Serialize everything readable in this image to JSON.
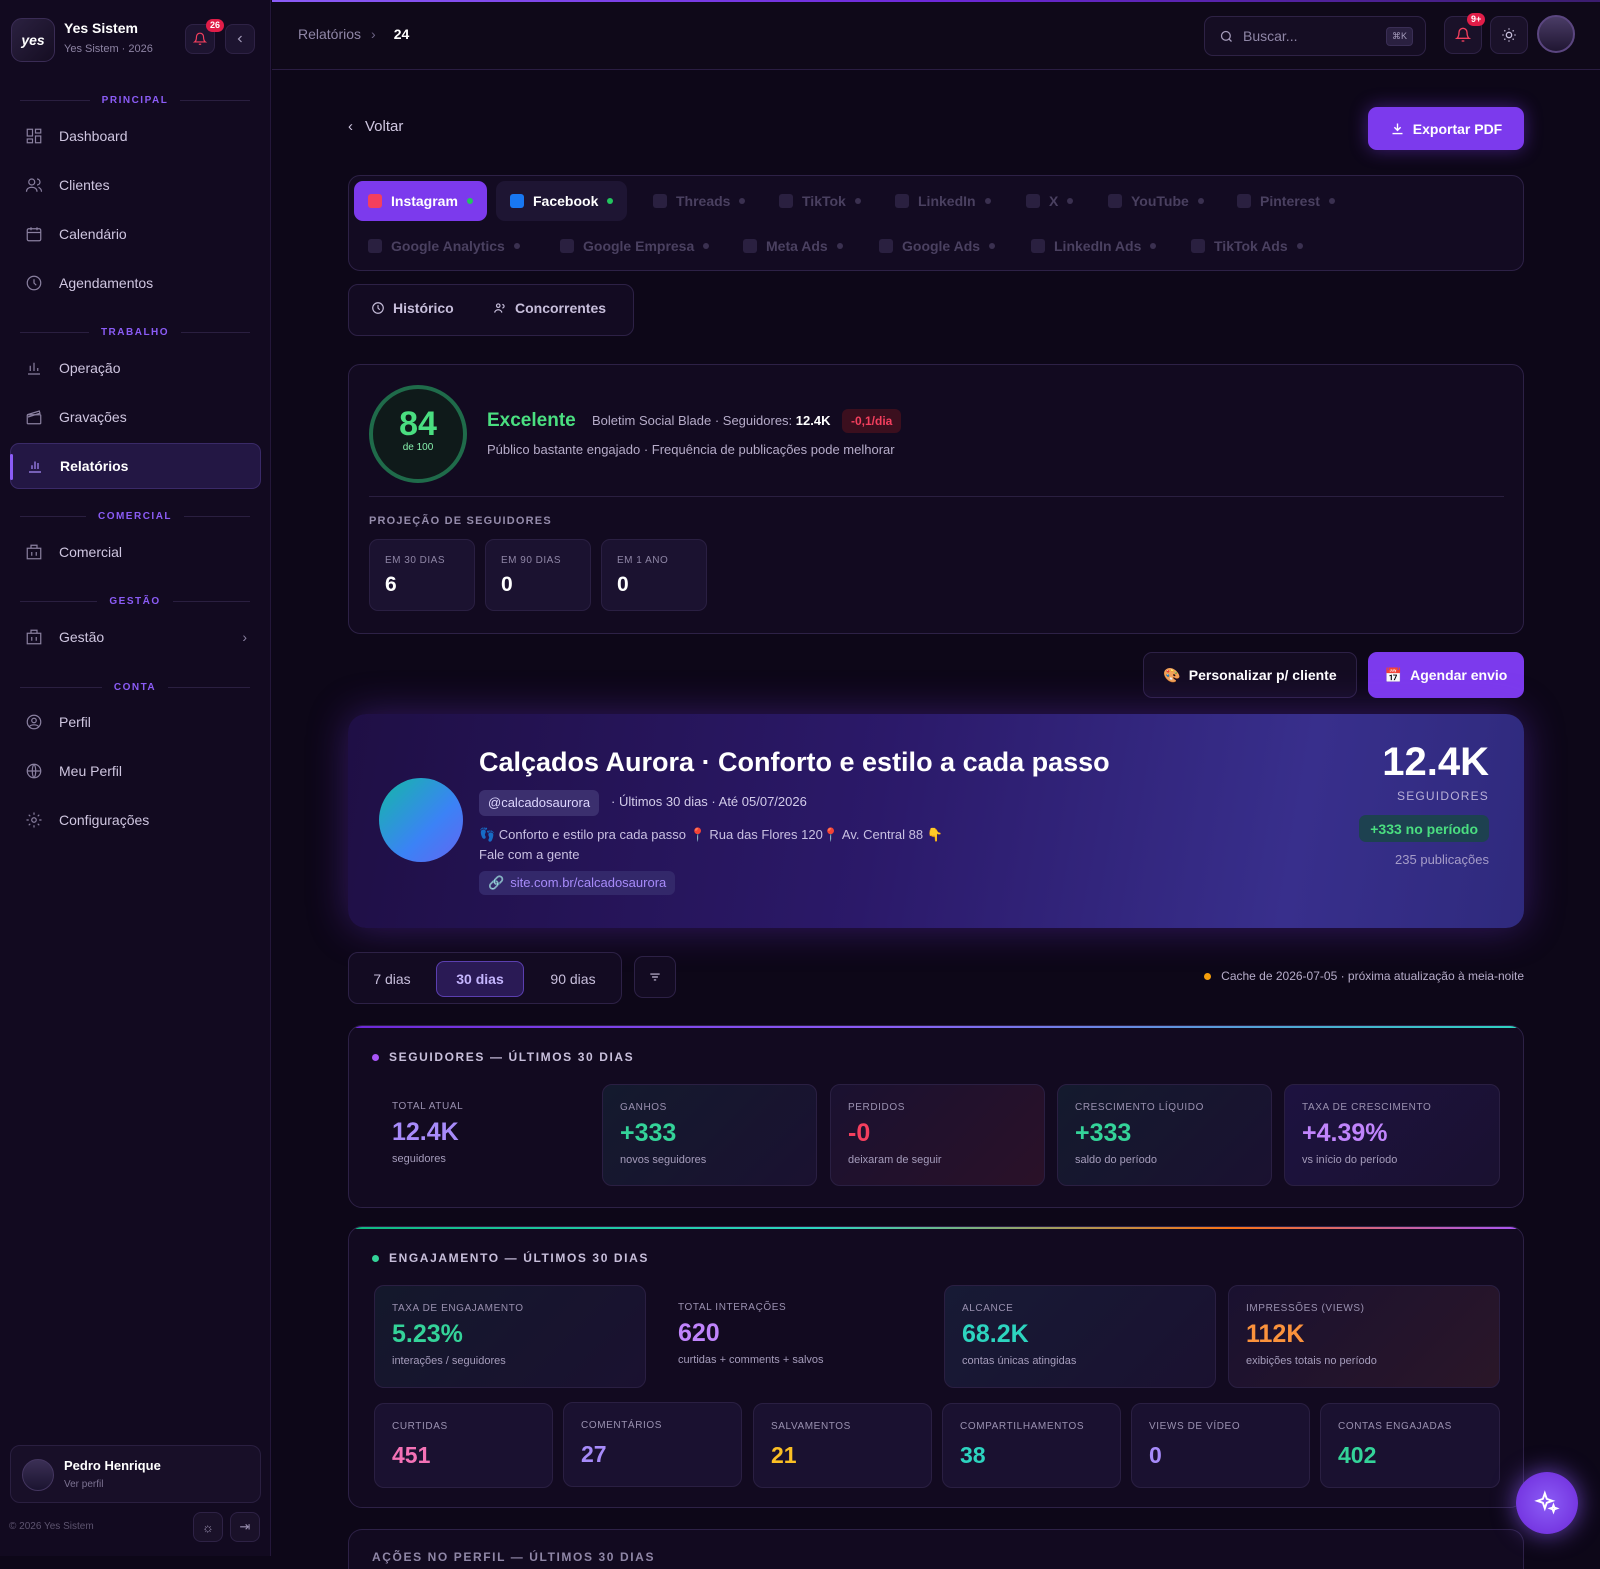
{
  "sidebar": {
    "brand_name": "Yes Sistem",
    "brand_sub": "Yes Sistem · 2026",
    "logo_text": "yes",
    "notif_count": "26",
    "sections": {
      "principal": "PRINCIPAL",
      "trabalho": "TRABALHO",
      "comercial": "COMERCIAL",
      "gestao": "GESTÃO",
      "conta": "CONTA"
    },
    "items": [
      "Dashboard",
      "Clientes",
      "Calendário",
      "Agendamentos",
      "Operação",
      "Gravações",
      "Relatórios",
      "Comercial",
      "Gestão",
      "Perfil",
      "Meu Perfil",
      "Configurações"
    ],
    "user_name": "Pedro Henrique",
    "user_sub": "Ver perfil",
    "copyright": "© 2026 Yes Sistem"
  },
  "header": {
    "breadcrumb_root": "Relatórios",
    "breadcrumb_current": "24",
    "search_placeholder": "Buscar...",
    "search_shortcut": "⌘K",
    "notif_badge": "9+"
  },
  "actions": {
    "back": "Voltar",
    "export": "Exportar PDF"
  },
  "networks": [
    "Instagram",
    "Facebook",
    "Threads",
    "TikTok",
    "LinkedIn",
    "X",
    "YouTube",
    "Pinterest",
    "Google Analytics",
    "Google Empresa",
    "Meta Ads",
    "Google Ads",
    "LinkedIn Ads",
    "TikTok Ads"
  ],
  "subtabs": {
    "history": "Histórico",
    "competitors": "Concorrentes"
  },
  "score": {
    "value": "84",
    "of": "de 100",
    "rating": "Excelente",
    "bulletin": "Boletim Social Blade · Seguidores:",
    "followers": "12.4K",
    "delta": "-0,1/dia",
    "description": "Público bastante engajado · Frequência de publicações pode melhorar",
    "projection_title": "PROJEÇÃO DE SEGUIDORES",
    "projections": [
      {
        "label": "EM 30 DIAS",
        "value": "6"
      },
      {
        "label": "EM 90 DIAS",
        "value": "0"
      },
      {
        "label": "EM 1 ANO",
        "value": "0"
      }
    ]
  },
  "buttons": {
    "personalize": "Personalizar p/ cliente",
    "schedule": "Agendar envio"
  },
  "profile": {
    "title": "Calçados Aurora · Conforto e estilo a cada passo",
    "handle": "@calcadosaurora",
    "meta": "· Últimos 30 dias · Até 05/07/2026",
    "bio_line1": "👣 Conforto e estilo pra cada passo 📍 Rua das Flores 120📍 Av. Central 88 👇",
    "bio_line2": "Fale com a gente",
    "link": "site.com.br/calcadosaurora",
    "followers": "12.4K",
    "followers_label": "SEGUIDORES",
    "gain": "+333 no período",
    "posts": "235 publicações"
  },
  "periods": {
    "p7": "7 dias",
    "p30": "30 dias",
    "p90": "90 dias",
    "cache": "Cache de 2026-07-05 · próxima atualização à meia-noite"
  },
  "followers_card": {
    "title": "SEGUIDORES — ÚLTIMOS 30 DIAS",
    "metrics": [
      {
        "label": "TOTAL ATUAL",
        "value": "12.4K",
        "sub": "seguidores",
        "color": "#a78bfa"
      },
      {
        "label": "GANHOS",
        "value": "+333",
        "sub": "novos seguidores",
        "color": "#34d399"
      },
      {
        "label": "PERDIDOS",
        "value": "-0",
        "sub": "deixaram de seguir",
        "color": "#f43f5e"
      },
      {
        "label": "CRESCIMENTO LÍQUIDO",
        "value": "+333",
        "sub": "saldo do período",
        "color": "#34d399"
      },
      {
        "label": "TAXA DE CRESCIMENTO",
        "value": "+4.39%",
        "sub": "vs início do período",
        "color": "#c084fc"
      }
    ]
  },
  "engagement_card": {
    "title": "ENGAJAMENTO — ÚLTIMOS 30 DIAS",
    "top": [
      {
        "label": "TAXA DE ENGAJAMENTO",
        "value": "5.23%",
        "sub": "interações / seguidores",
        "color": "#34d399"
      },
      {
        "label": "TOTAL INTERAÇÕES",
        "value": "620",
        "sub": "curtidas + comments + salvos",
        "color": "#c084fc"
      },
      {
        "label": "ALCANCE",
        "value": "68.2K",
        "sub": "contas únicas atingidas",
        "color": "#2dd4bf"
      },
      {
        "label": "IMPRESSÕES (VIEWS)",
        "value": "112K",
        "sub": "exibições totais no período",
        "color": "#fb923c"
      }
    ],
    "bottom": [
      {
        "label": "CURTIDAS",
        "value": "451",
        "color": "#f472b6"
      },
      {
        "label": "COMENTÁRIOS",
        "value": "27",
        "color": "#a78bfa"
      },
      {
        "label": "SALVAMENTOS",
        "value": "21",
        "color": "#fbbf24"
      },
      {
        "label": "COMPARTILHAMENTOS",
        "value": "38",
        "color": "#2dd4bf"
      },
      {
        "label": "VIEWS DE VÍDEO",
        "value": "0",
        "color": "#a78bfa"
      },
      {
        "label": "CONTAS ENGAJADAS",
        "value": "402",
        "color": "#34d399"
      }
    ]
  },
  "next_card_title": "AÇÕES NO PERFIL — ÚLTIMOS 30 DIAS"
}
